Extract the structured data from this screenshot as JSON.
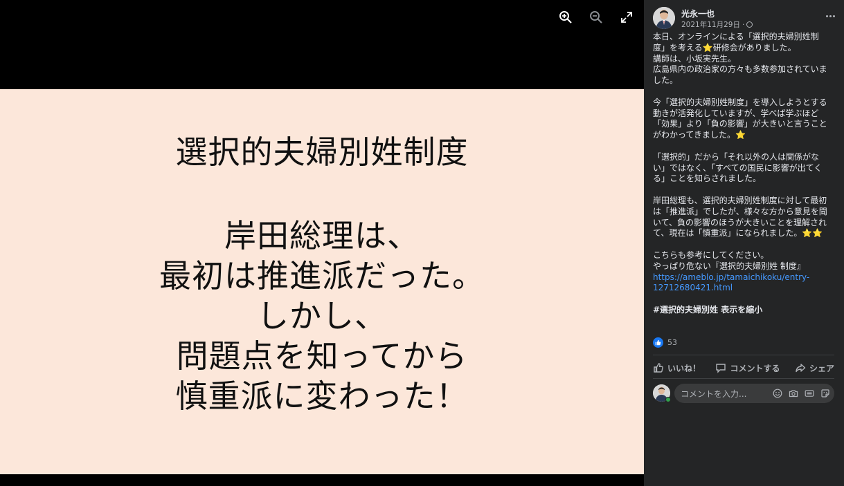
{
  "viewer": {
    "tools": [
      {
        "icon": "zoom-in-icon"
      },
      {
        "icon": "zoom-out-icon"
      },
      {
        "icon": "fullscreen-icon"
      }
    ],
    "slide": {
      "title": "選択的夫婦別姓制度",
      "lines": [
        "岸田総理は、",
        "最初は推進派だった。",
        "しかし、",
        "問題点を知ってから",
        "慎重派に変わった！"
      ]
    }
  },
  "post": {
    "author": "光永一也",
    "date": "2021年11月29日",
    "privacy_icon": "globe-icon",
    "paragraphs": [
      [
        "本日、オンラインによる「選択的夫婦別姓制",
        "度」を考える⭐研修会がありました。",
        "講師は、小坂実先生。",
        "広島県内の政治家の方々も多数参加されていま",
        "した。"
      ],
      [
        "今「選択的夫婦別姓制度」を導入しようとする",
        "動きが活発化していますが、学べば学ぶほど",
        "「効果」より「負の影響」が大きいと言うこと",
        "がわかってきました。⭐"
      ],
      [
        "「選択的」だから「それ以外の人は関係がな",
        "い」ではなく、「すべての国民に影響が出てく",
        "る」ことを知らされました。"
      ],
      [
        "岸田総理も、選択的夫婦別姓制度に対して最初",
        "は「推進派」でしたが、様々な方から意見を聞",
        "いて、負の影響のほうが大きいことを理解され",
        "て、現在は「慎重派」になられました。⭐⭐"
      ]
    ],
    "ref_lines": [
      "こちらも参考にしてください。",
      "やっぱり危ない『選択的夫婦別姓 制度』"
    ],
    "link_lines": [
      "https://ameblo.jp/tamaichikoku/entry-",
      "12712680421.html"
    ],
    "hashtag": "#選択的夫婦別姓 表示を縮小",
    "reaction_count": "53",
    "actions": {
      "like": "いいね！",
      "comment": "コメントする",
      "share": "シェア"
    },
    "comment_placeholder": "コメントを入力..."
  },
  "colors": {
    "panel_bg": "#242526",
    "slide_bg": "#fce7da",
    "link": "#4599ff",
    "like_blue": "#1877f2",
    "online_green": "#31a24c"
  }
}
